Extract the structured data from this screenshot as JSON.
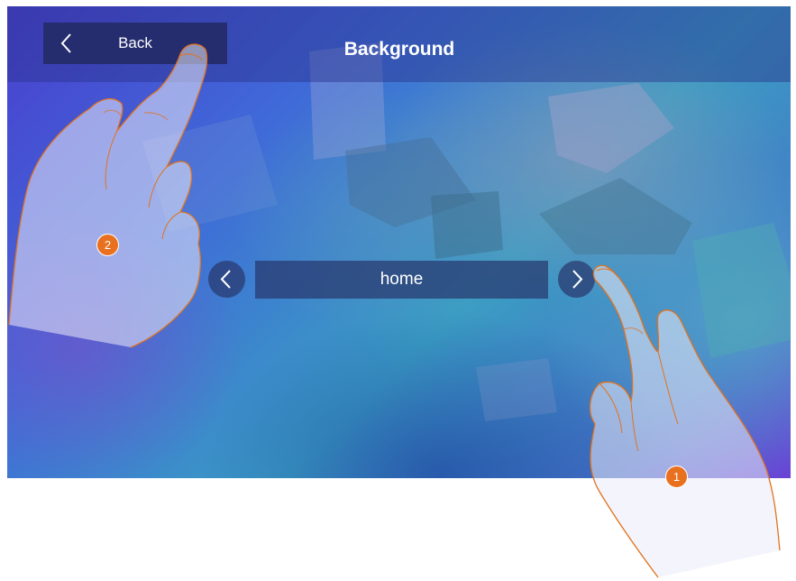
{
  "header": {
    "back_label": "Back",
    "title": "Background"
  },
  "selector": {
    "value": "home"
  },
  "callouts": {
    "step_1": "1",
    "step_2": "2"
  },
  "colors": {
    "header_bar": "#252d6e",
    "callout_badge": "#e8701f",
    "hand_outline": "#e0731f"
  },
  "icons": {
    "back": "chevron-left-icon",
    "previous": "chevron-left-icon",
    "next": "chevron-right-icon"
  }
}
